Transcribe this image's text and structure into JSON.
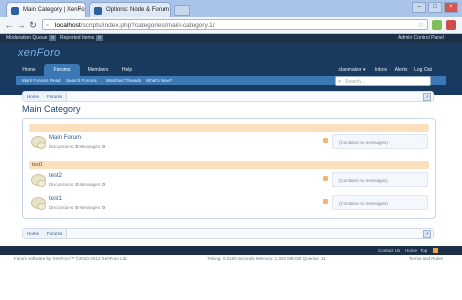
{
  "browser": {
    "tabs": [
      {
        "title": "Main Category | XenFo",
        "close": "×"
      },
      {
        "title": "Options: Node & Forum",
        "close": "×"
      }
    ],
    "window_controls": [
      "–",
      "□",
      "×"
    ],
    "nav": {
      "back": "←",
      "forward": "→",
      "reload": "↻"
    },
    "url_host": "localhost",
    "url_path": "/scripts/index.php?categories/main-category.1/"
  },
  "adminbar": {
    "moderation_queue": "Moderation Queue",
    "moderation_count": "0",
    "reported_items": "Reported Items",
    "reported_count": "0",
    "admin_panel": "Admin Control Panel"
  },
  "header": {
    "logo": "xenForo"
  },
  "navtabs": {
    "home": "Home",
    "forums": "Forums",
    "members": "Members",
    "help": "Help",
    "username": "clanmaker",
    "username_arrow": "▾",
    "inbox": "Inbox",
    "alerts": "Alerts",
    "logout": "Log Out"
  },
  "subnav": [
    "Mark Forums Read",
    "Search Forums",
    "Watched Threads",
    "What's New?"
  ],
  "search": {
    "placeholder": "Search..."
  },
  "breadcrumb": {
    "home": "Home",
    "forums": "Forums",
    "jump": "↗"
  },
  "page_title": "Main Category",
  "nodes": [
    {
      "category": "",
      "name": "Main Forum",
      "discussions_label": "Discussions:",
      "discussions": "0",
      "messages_label": "Messages:",
      "messages": "0",
      "last": "(Contains no messages)"
    },
    {
      "category": "test1",
      "name": "test2",
      "discussions_label": "Discussions:",
      "discussions": "0",
      "messages_label": "Messages:",
      "messages": "0",
      "last": "(Contains no messages)"
    },
    {
      "category": "",
      "name": "test1",
      "discussions_label": "Discussions:",
      "discussions": "0",
      "messages_label": "Messages:",
      "messages": "0",
      "last": "(Contains no messages)"
    }
  ],
  "footer": {
    "contact": "Contact Us",
    "home": "Home",
    "top": "Top",
    "software": "Forum software by XenForo™ ©2010-2012 XenForo Ltd.",
    "timing": "Timing: 0.0160 seconds Memory: 1.329 MB DB Queries: 11",
    "terms": "Terms and Rules"
  },
  "colors": {
    "header": "#183a61",
    "tab_selected": "#3c78b4",
    "category": "#fbe0bd"
  }
}
